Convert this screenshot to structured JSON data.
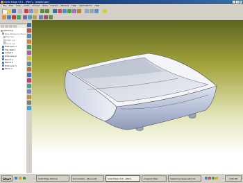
{
  "window": {
    "title": "Solid Edge V15 - [Part] - [staple.par]"
  },
  "menu": [
    "File",
    "Edit",
    "View",
    "Insert",
    "Format",
    "Tools",
    "Inspect",
    "Window",
    "Help",
    "Applications",
    "Help"
  ],
  "pathfinder": {
    "items": [
      {
        "label": "staple.par",
        "icon": "part-icon"
      },
      {
        "label": "Base Reference Planes",
        "icon": "planes-icon"
      },
      {
        "label": "Top (xy)",
        "icon": "plane-icon"
      },
      {
        "label": "Right (yz)",
        "icon": "plane-icon"
      },
      {
        "label": "Front (xz)",
        "icon": "plane-icon"
      },
      {
        "label": "Protrusion 1",
        "icon": "feature-icon"
      },
      {
        "label": "Thin Wall 1",
        "icon": "feature-icon"
      },
      {
        "label": "Cutout 1",
        "icon": "feature-icon"
      },
      {
        "label": "Protrusion 2",
        "icon": "feature-icon"
      },
      {
        "label": "Round 1",
        "icon": "feature-icon"
      },
      {
        "label": "Round 2",
        "icon": "feature-icon"
      },
      {
        "label": "Protrusion 3",
        "icon": "feature-icon"
      },
      {
        "label": "Mirror 1",
        "icon": "feature-icon"
      }
    ]
  },
  "taskbar": {
    "start_label": "Start",
    "tasks": [
      {
        "label": "Solid Edge Tutorial",
        "active": false
      },
      {
        "label": "Document1 - Microsoft",
        "active": false
      },
      {
        "label": "Solid Edge V15 - [Part]",
        "active": true
      },
      {
        "label": "Program Files",
        "active": false
      },
      {
        "label": "Capturing Application Pr",
        "active": false
      }
    ],
    "clock": "3:04 PM"
  },
  "colors": {
    "titlebar": "#0a246a",
    "background_top": "#5e6420",
    "background_bottom": "#ffffff",
    "part_face": "#c4cbdc"
  }
}
